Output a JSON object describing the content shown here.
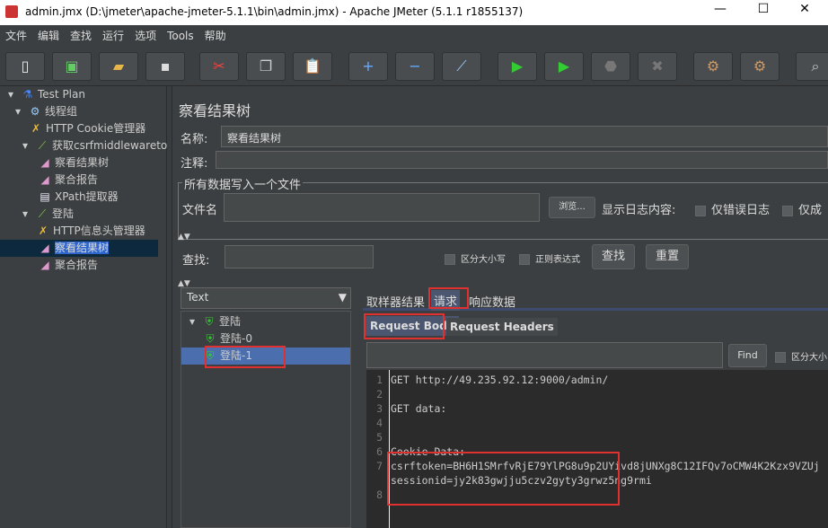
{
  "window": {
    "title": "admin.jmx (D:\\jmeter\\apache-jmeter-5.1.1\\bin\\admin.jmx) - Apache JMeter (5.1.1 r1855137)",
    "min": "—",
    "max": "☐",
    "close": "✕"
  },
  "menu": [
    "文件",
    "编辑",
    "查找",
    "运行",
    "选项",
    "Tools",
    "帮助"
  ],
  "tree": [
    {
      "label": "Test Plan",
      "icon": "flask-icon"
    },
    {
      "label": "线程组",
      "icon": "gear-icon"
    },
    {
      "label": "HTTP Cookie管理器",
      "icon": "tools-icon"
    },
    {
      "label": "获取csrfmiddlewareto",
      "icon": "sampler-icon"
    },
    {
      "label": "察看结果树",
      "icon": "listener-icon"
    },
    {
      "label": "聚合报告",
      "icon": "listener-icon"
    },
    {
      "label": "XPath提取器",
      "icon": "extractor-icon"
    },
    {
      "label": "登陆",
      "icon": "sampler-icon"
    },
    {
      "label": "HTTP信息头管理器",
      "icon": "tools-icon"
    },
    {
      "label": "察看结果树",
      "icon": "listener-icon"
    },
    {
      "label": "聚合报告",
      "icon": "listener-icon"
    }
  ],
  "panel": {
    "title": "察看结果树",
    "name_label": "名称:",
    "name_value": "察看结果树",
    "comment_label": "注释:",
    "file_group": "所有数据写入一个文件",
    "file_label": "文件名",
    "browse": "浏览...",
    "log_label": "显示日志内容:",
    "errors_only": "仅错误日志",
    "success_only": "仅成",
    "search_label": "查找:",
    "case_sensitive": "区分大小写",
    "regex": "正则表达式",
    "find": "查找",
    "reset": "重置",
    "renderer": "Text",
    "results": [
      {
        "label": "登陆"
      },
      {
        "label": "登陆-0"
      },
      {
        "label": "登陆-1"
      }
    ],
    "tabs": [
      "取样器结果",
      "请求",
      "响应数据"
    ],
    "subtabs": [
      "Request Body",
      "Request Headers"
    ],
    "find_btn": "Find",
    "find_case": "区分大小"
  },
  "code": [
    {
      "n": "1",
      "text": "GET http://49.235.92.12:9000/admin/"
    },
    {
      "n": "2",
      "text": ""
    },
    {
      "n": "3",
      "text": "GET data:"
    },
    {
      "n": "4",
      "text": ""
    },
    {
      "n": "5",
      "text": ""
    },
    {
      "n": "6",
      "text": "Cookie Data:"
    },
    {
      "n": "7",
      "text": "csrftoken=BH6H1SMrfvRjE79YlPG8u9p2UYivd8jUNXg8C12IFQv7oCMW4K2Kzx9VZUj"
    },
    {
      "n": "",
      "text": "sessionid=jy2k83gwjju5czv2gyty3grwz5ng9rmi"
    },
    {
      "n": "8",
      "text": ""
    }
  ]
}
